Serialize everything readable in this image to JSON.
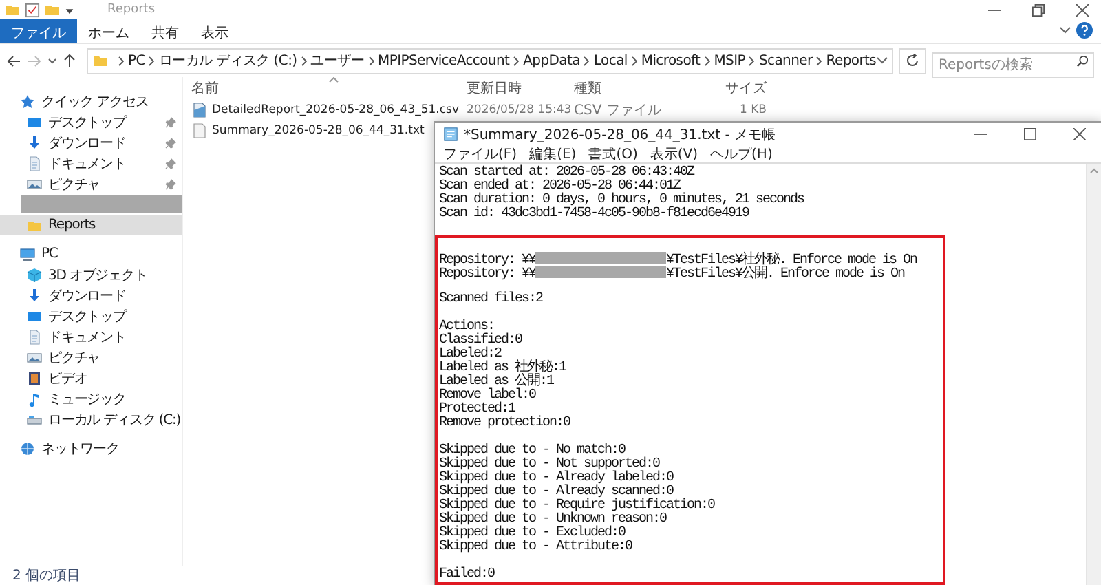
{
  "explorer": {
    "title": "Reports",
    "ribbon_tabs": [
      {
        "label": "ファイル",
        "selected": true
      },
      {
        "label": "ホーム",
        "selected": false
      },
      {
        "label": "共有",
        "selected": false
      },
      {
        "label": "表示",
        "selected": false
      }
    ],
    "address_path": [
      "PC",
      "ローカル ディスク (C:)",
      "ユーザー",
      "MPIPServiceAccount",
      "AppData",
      "Local",
      "Microsoft",
      "MSIP",
      "Scanner",
      "Reports"
    ],
    "search": {
      "placeholder": "Reportsの検索"
    },
    "sidebar": [
      {
        "label": "クイック アクセス",
        "kind": "star",
        "selected": false,
        "children": [
          {
            "label": "デスクトップ",
            "kind": "desktop",
            "pinned": true,
            "selected": false
          },
          {
            "label": "ダウンロード",
            "kind": "download",
            "pinned": true,
            "selected": false
          },
          {
            "label": "ドキュメント",
            "kind": "document",
            "pinned": true,
            "selected": false
          },
          {
            "label": "ピクチャ",
            "kind": "picture",
            "pinned": true,
            "selected": false
          },
          {
            "kind": "redacted"
          },
          {
            "label": "Reports",
            "kind": "folder",
            "pinned": false,
            "selected": true
          }
        ]
      },
      {
        "label": "PC",
        "kind": "pc",
        "selected": false,
        "children": [
          {
            "label": "3D オブジェクト",
            "kind": "cube",
            "selected": false
          },
          {
            "label": "ダウンロード",
            "kind": "download",
            "selected": false
          },
          {
            "label": "デスクトップ",
            "kind": "desktop",
            "selected": false
          },
          {
            "label": "ドキュメント",
            "kind": "document",
            "selected": false
          },
          {
            "label": "ピクチャ",
            "kind": "picture",
            "selected": false
          },
          {
            "label": "ビデオ",
            "kind": "video",
            "selected": false
          },
          {
            "label": "ミュージック",
            "kind": "music",
            "selected": false
          },
          {
            "label": "ローカル ディスク (C:)",
            "kind": "drive",
            "selected": false
          }
        ]
      },
      {
        "label": "ネットワーク",
        "kind": "network",
        "selected": false
      }
    ],
    "columns": [
      {
        "label": "名前",
        "sorted": true
      },
      {
        "label": "更新日時",
        "sorted": false
      },
      {
        "label": "種類",
        "sorted": false
      },
      {
        "label": "サイズ",
        "sorted": false
      }
    ],
    "files": [
      {
        "name": "DetailedReport_2026-05-28_06_43_51.csv",
        "kind": "csv",
        "modified": "2026/05/28 15:43",
        "type": "CSV ファイル",
        "size": "1 KB"
      },
      {
        "name": "Summary_2026-05-28_06_44_31.txt",
        "kind": "txt"
      }
    ],
    "status": "2 個の項目"
  },
  "notepad": {
    "title": "*Summary_2026-05-28_06_44_31.txt - メモ帳",
    "menu": [
      "ファイル(F)",
      "編集(E)",
      "書式(O)",
      "表示(V)",
      "ヘルプ(H)"
    ],
    "lines": [
      {
        "kind": "text",
        "text": "Scan started at: 2026-05-28 06:43:40Z"
      },
      {
        "kind": "text",
        "text": "Scan ended at: 2026-05-28 06:44:01Z"
      },
      {
        "kind": "text",
        "text": "Scan duration: 0 days, 0 hours, 0 minutes, 21 seconds"
      },
      {
        "kind": "text",
        "text": "Scan id: 43dc3bd1-7458-4c05-90b8-f81ecd6e4919"
      },
      {
        "kind": "blank"
      }
    ],
    "highlighted_lines": [
      {
        "kind": "blank"
      },
      {
        "kind": "redacted",
        "before": "Repository: ¥¥",
        "after": "¥TestFiles¥社外秘. Enforce mode is On"
      },
      {
        "kind": "redacted",
        "before": "Repository: ¥¥",
        "after": "¥TestFiles¥公開. Enforce mode is On"
      },
      {
        "kind": "blank"
      },
      {
        "kind": "text",
        "text": "Scanned files:2"
      },
      {
        "kind": "blank"
      },
      {
        "kind": "text",
        "text": "Actions:"
      },
      {
        "kind": "text",
        "text": "Classified:0"
      },
      {
        "kind": "text",
        "text": "Labeled:2"
      },
      {
        "kind": "text",
        "text": "Labeled as 社外秘:1"
      },
      {
        "kind": "text",
        "text": "Labeled as 公開:1"
      },
      {
        "kind": "text",
        "text": "Remove label:0"
      },
      {
        "kind": "text",
        "text": "Protected:1"
      },
      {
        "kind": "text",
        "text": "Remove protection:0"
      },
      {
        "kind": "blank"
      },
      {
        "kind": "text",
        "text": "Skipped due to - No match:0"
      },
      {
        "kind": "text",
        "text": "Skipped due to - Not supported:0"
      },
      {
        "kind": "text",
        "text": "Skipped due to - Already labeled:0"
      },
      {
        "kind": "text",
        "text": "Skipped due to - Already scanned:0"
      },
      {
        "kind": "text",
        "text": "Skipped due to - Require justification:0"
      },
      {
        "kind": "text",
        "text": "Skipped due to - Unknown reason:0"
      },
      {
        "kind": "text",
        "text": "Skipped due to - Excluded:0"
      },
      {
        "kind": "text",
        "text": "Skipped due to - Attribute:0"
      },
      {
        "kind": "blank"
      },
      {
        "kind": "text",
        "text": "Failed:0"
      }
    ]
  }
}
